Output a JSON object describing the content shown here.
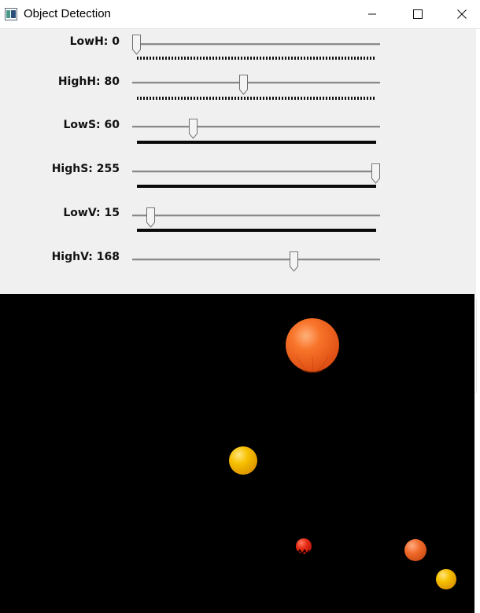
{
  "window": {
    "title": "Object Detection",
    "icon": "opencv-window-icon"
  },
  "trackbars": [
    {
      "label": "LowH: 0",
      "value": 0,
      "max": 179,
      "bar": "dotted"
    },
    {
      "label": "HighH: 80",
      "value": 80,
      "max": 179,
      "bar": "dotted"
    },
    {
      "label": "LowS: 60",
      "value": 60,
      "max": 255,
      "bar": "solid"
    },
    {
      "label": "HighS: 255",
      "value": 255,
      "max": 255,
      "bar": "solid"
    },
    {
      "label": "LowV: 15",
      "value": 15,
      "max": 255,
      "bar": "solid"
    },
    {
      "label": "HighV: 168",
      "value": 168,
      "max": 255,
      "bar": "none"
    }
  ],
  "image": {
    "background": "#000000",
    "objects": [
      {
        "name": "large-orange-balloon",
        "color": "#f26a1e"
      },
      {
        "name": "yellow-ball-center",
        "color": "#f5b800"
      },
      {
        "name": "small-red-ball",
        "color": "#e02010"
      },
      {
        "name": "orange-ball-right",
        "color": "#f06a2a"
      },
      {
        "name": "yellow-ball-bottom-right",
        "color": "#f2b000"
      }
    ]
  }
}
